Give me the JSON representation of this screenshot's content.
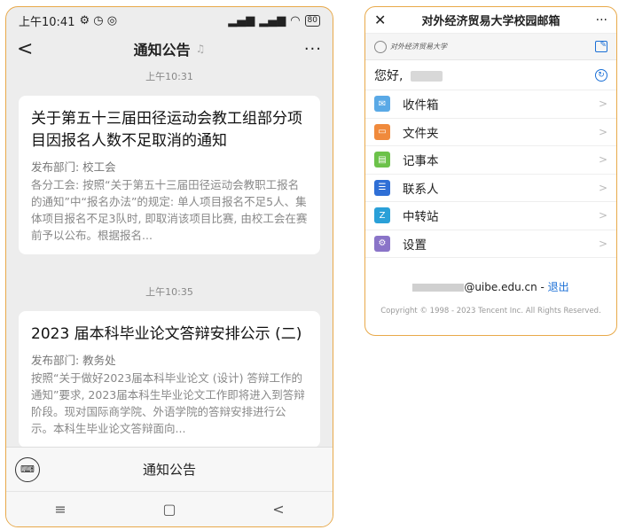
{
  "left_phone": {
    "status": {
      "time": "上午10:41",
      "battery": "80"
    },
    "title": "通知公告",
    "posts": [
      {
        "time": "上午10:31",
        "title": "关于第五十三届田径运动会教工组部分项目因报名人数不足取消的通知",
        "dept": "发布部门: 校工会",
        "body": "各分工会: 按照“关于第五十三届田径运动会教职工报名的通知”中“报名办法”的规定: 单人项目报名不足5人、集体项目报名不足3队时, 即取消该项目比赛, 由校工会在赛前予以公布。根据报名..."
      },
      {
        "time": "上午10:35",
        "title": "2023 届本科毕业论文答辩安排公示 (二)",
        "dept": "发布部门: 教务处",
        "body": "按照“关于做好2023届本科毕业论文 (设计) 答辩工作的通知”要求, 2023届本科生毕业论文工作即将进入到答辩阶段。现对国际商学院、外语学院的答辩安排进行公示。本科生毕业论文答辩面向..."
      }
    ],
    "bottom_label": "通知公告",
    "nav": {
      "menu": "≡",
      "home": "▢",
      "back": "<"
    }
  },
  "right_phone": {
    "title": "对外经济贸易大学校园邮箱",
    "logo_text": "对外经济贸易大学",
    "greeting": "您好,",
    "menu": [
      {
        "label": "收件箱",
        "color": "#5aa9e6",
        "glyph": "✉"
      },
      {
        "label": "文件夹",
        "color": "#f08a3c",
        "glyph": "▭"
      },
      {
        "label": "记事本",
        "color": "#6cc24a",
        "glyph": "▤"
      },
      {
        "label": "联系人",
        "color": "#2f6fd6",
        "glyph": "☰"
      },
      {
        "label": "中转站",
        "color": "#2aa0d8",
        "glyph": "Z"
      },
      {
        "label": "设置",
        "color": "#8a74c8",
        "glyph": "⚙"
      }
    ],
    "account_domain": "@uibe.edu.cn",
    "separator": " - ",
    "logout": "退出",
    "copyright": "Copyright © 1998 - 2023 Tencent Inc. All Rights Reserved."
  }
}
